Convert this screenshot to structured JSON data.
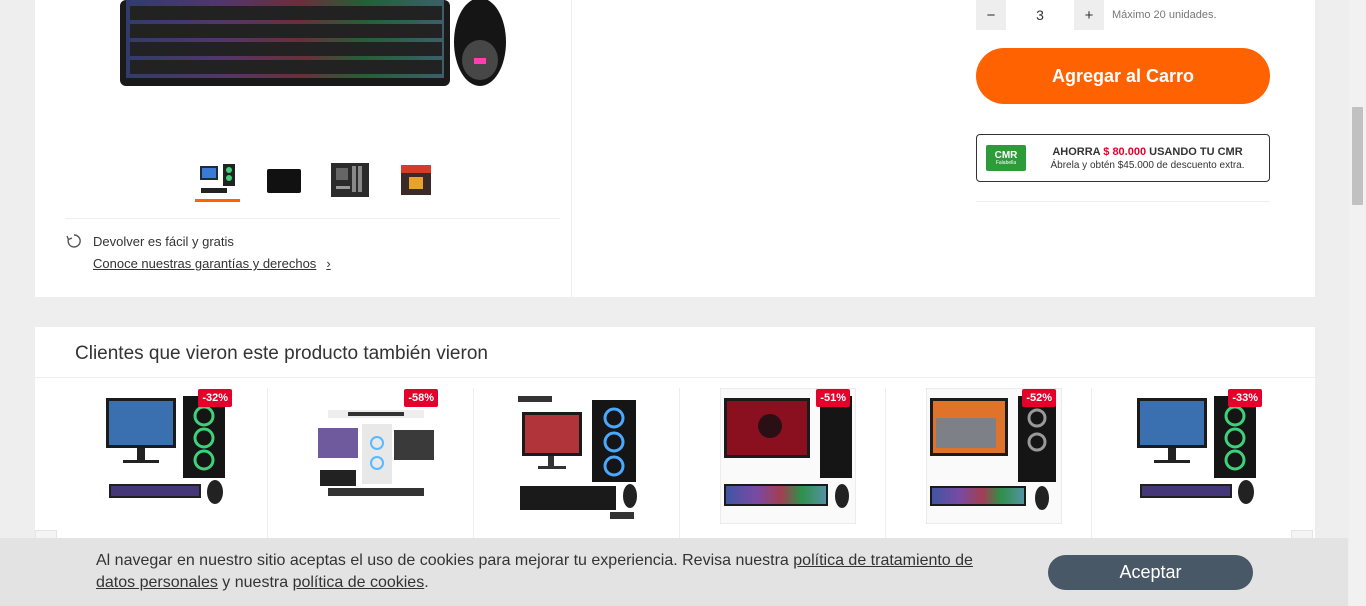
{
  "gallery": {
    "thumbnails": [
      {
        "name": "pc-setup-thumbnail",
        "active": true
      },
      {
        "name": "mousepad-thumbnail",
        "active": false
      },
      {
        "name": "motherboard-thumbnail",
        "active": false
      },
      {
        "name": "processor-box-thumbnail",
        "active": false
      }
    ],
    "returns_text": "Devolver es fácil y gratis",
    "returns_link": "Conoce nuestras garantías y derechos"
  },
  "buybox": {
    "minus_label": "−",
    "quantity": "3",
    "plus_label": "+",
    "max_text": "Máximo 20 unidades.",
    "cart_button": "Agregar al Carro",
    "cmr": {
      "logo_text": "CMR",
      "logo_sub": "Falabella",
      "save_prefix": "AHORRA",
      "save_amount": "$ 80.000",
      "save_suffix": "USANDO TU CMR",
      "subtext": "Ábrela y obtén $45.000 de descuento extra."
    }
  },
  "recommendations": {
    "title": "Clientes que vieron este producto también vieron",
    "cards": [
      {
        "discount": "-32%"
      },
      {
        "discount": "-58%"
      },
      {
        "discount": ""
      },
      {
        "discount": "-51%"
      },
      {
        "discount": "-52%"
      },
      {
        "discount": "-33%"
      }
    ]
  },
  "cookie": {
    "text_1": "Al navegar en nuestro sitio aceptas el uso de cookies para mejorar tu experiencia. Revisa nuestra ",
    "link_1": "política de tratamiento de datos personales",
    "text_2": " y nuestra ",
    "link_2": "política de cookies",
    "text_3": ".",
    "accept_button": "Aceptar"
  },
  "colors": {
    "accent": "#ff6200",
    "discount": "#e4002b",
    "cmr_green": "#2d9b3a",
    "accept_button": "#495867"
  }
}
